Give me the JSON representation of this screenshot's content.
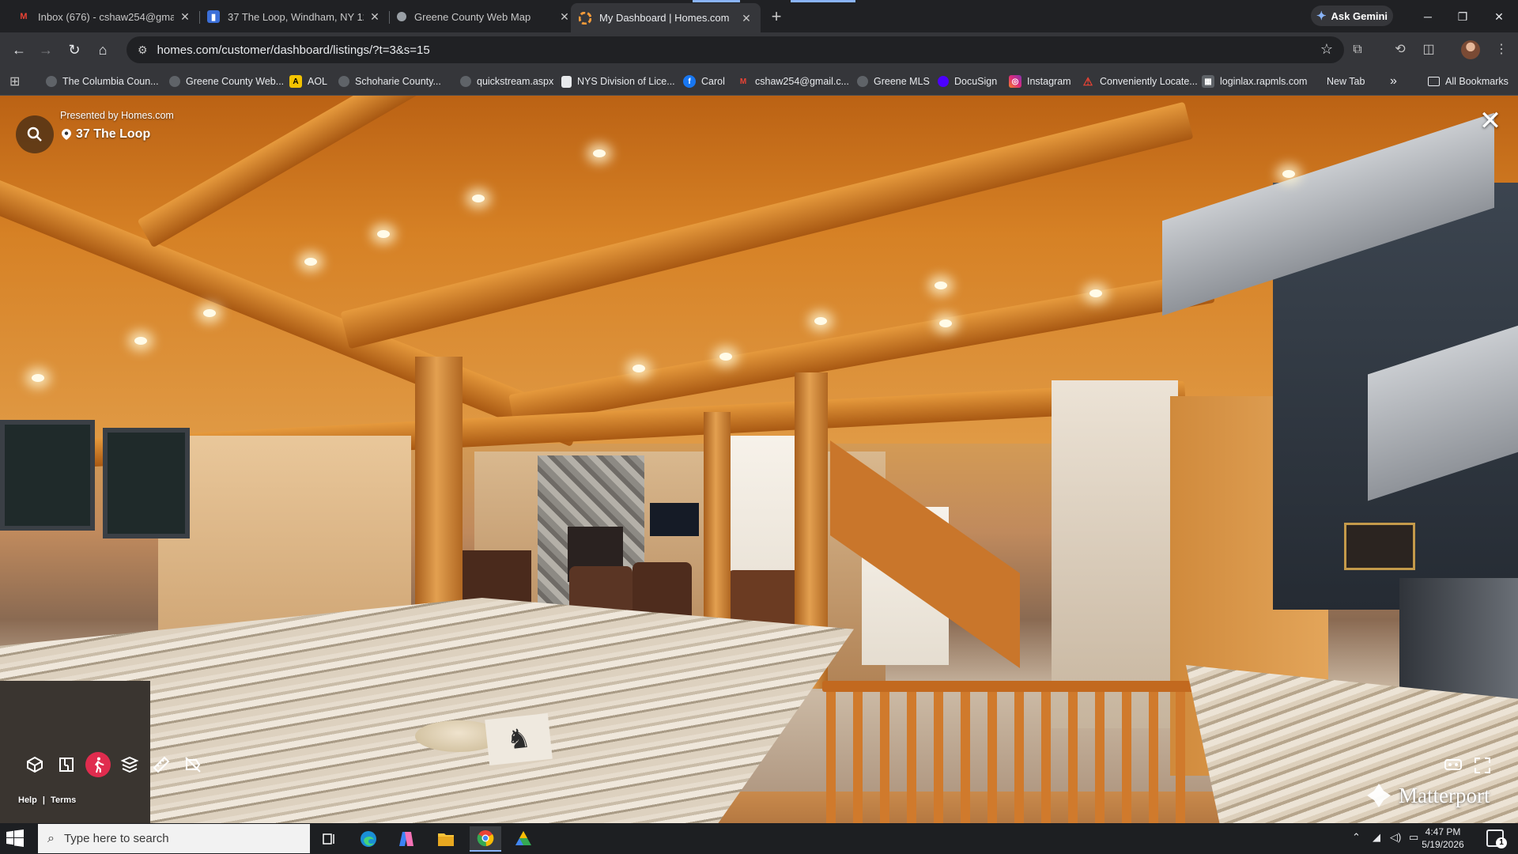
{
  "browser": {
    "tabs": [
      {
        "title": "Inbox (676) - cshaw254@gmail.",
        "icon": "gmail-icon",
        "active": false
      },
      {
        "title": "37 The Loop, Windham, NY 124",
        "icon": "realestate-icon",
        "active": false
      },
      {
        "title": "Greene County Web Map",
        "icon": "globe-icon",
        "active": false
      },
      {
        "title": "My Dashboard | Homes.com",
        "icon": "homes-icon",
        "active": true
      }
    ],
    "new_tab_label": "+",
    "ask_gemini_label": "Ask Gemini",
    "url": "homes.com/customer/dashboard/listings/?t=3&s=15",
    "bookmarks": [
      {
        "label": "The Columbia Coun...",
        "icon": "globe-icon",
        "color": "#5f6368"
      },
      {
        "label": "Greene County Web...",
        "icon": "globe-icon",
        "color": "#5f6368"
      },
      {
        "label": "AOL",
        "icon": "aol-icon",
        "color": "#f3c300"
      },
      {
        "label": "Schoharie County...",
        "icon": "globe-icon",
        "color": "#5f6368"
      },
      {
        "label": "quickstream.aspx",
        "icon": "globe-icon",
        "color": "#5f6368"
      },
      {
        "label": "NYS Division of Lice...",
        "icon": "page-icon",
        "color": "#e8eaed"
      },
      {
        "label": "Carol",
        "icon": "facebook-icon",
        "color": "#1877f2"
      },
      {
        "label": "cshaw254@gmail.c...",
        "icon": "gmail-icon",
        "color": "#ea4335"
      },
      {
        "label": "Greene MLS",
        "icon": "globe-icon",
        "color": "#5f6368"
      },
      {
        "label": "DocuSign",
        "icon": "docusign-icon",
        "color": "#4c00ff"
      },
      {
        "label": "Instagram",
        "icon": "instagram-icon",
        "color": "#e1306c"
      },
      {
        "label": "Conveniently Locate...",
        "icon": "location-icon",
        "color": "#ea4335"
      },
      {
        "label": "loginlax.rapmls.com",
        "icon": "page-icon",
        "color": "#5f6368"
      },
      {
        "label": "New Tab",
        "icon": "none",
        "color": "#35363a"
      }
    ],
    "bookmarks_overflow": "»",
    "all_bookmarks_label": "All Bookmarks"
  },
  "viewer": {
    "presented_by": "Presented by Homes.com",
    "address": "37 The Loop",
    "tools": [
      "dollhouse-icon",
      "floorplan-icon",
      "walk-icon",
      "floors-icon",
      "measure-icon",
      "hide-tags-icon"
    ],
    "active_tool": "walk-icon",
    "help_label": "Help",
    "separator": "|",
    "terms_label": "Terms",
    "brand": "Matterport",
    "accent_color": "#e02c4e"
  },
  "taskbar": {
    "search_placeholder": "Type here to search",
    "apps": [
      "task-view-icon",
      "edge-icon",
      "copilot-icon",
      "file-explorer-icon",
      "chrome-icon",
      "app-icon"
    ],
    "time": "4:47 PM",
    "date": "5/19/2026",
    "notification_count": "1"
  }
}
